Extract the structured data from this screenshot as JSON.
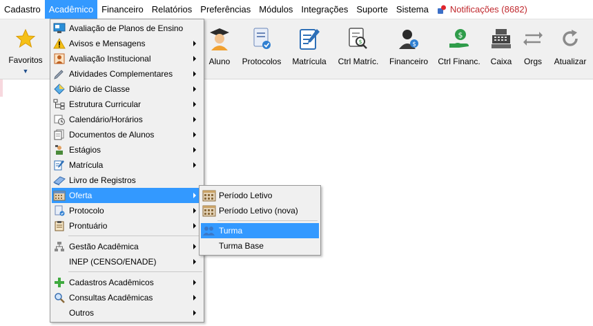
{
  "menubar": {
    "items": [
      {
        "label": "Cadastro"
      },
      {
        "label": "Acadêmico"
      },
      {
        "label": "Financeiro"
      },
      {
        "label": "Relatórios"
      },
      {
        "label": "Preferências"
      },
      {
        "label": "Módulos"
      },
      {
        "label": "Integrações"
      },
      {
        "label": "Suporte"
      },
      {
        "label": "Sistema"
      }
    ],
    "notifications": "Notificações (8682)"
  },
  "toolbar": {
    "favoritos": "Favoritos",
    "buttons": [
      {
        "label": "Aluno",
        "icon": "student-icon"
      },
      {
        "label": "Protocolos",
        "icon": "document-check-icon"
      },
      {
        "label": "Matrícula",
        "icon": "edit-document-icon"
      },
      {
        "label": "Ctrl Matríc.",
        "icon": "search-document-icon"
      },
      {
        "label": "Financeiro",
        "icon": "user-money-icon"
      },
      {
        "label": "Ctrl Financ.",
        "icon": "hand-money-icon"
      },
      {
        "label": "Caixa",
        "icon": "cash-register-icon"
      },
      {
        "label": "Orgs",
        "icon": "swap-arrows-icon"
      },
      {
        "label": "Atualizar",
        "icon": "refresh-icon"
      }
    ]
  },
  "dropdown": {
    "items": [
      {
        "label": "Avaliação de Planos de Ensino",
        "icon": "monitor-icon",
        "submenu": false
      },
      {
        "label": "Avisos e Mensagens",
        "icon": "warning-icon",
        "submenu": true
      },
      {
        "label": "Avaliação Institucional",
        "icon": "user-icon",
        "submenu": true
      },
      {
        "label": "Atividades Complementares",
        "icon": "pencil-icon",
        "submenu": true
      },
      {
        "label": "Diário de Classe",
        "icon": "diamond-icon",
        "submenu": true
      },
      {
        "label": "Estrutura Curricular",
        "icon": "tree-icon",
        "submenu": true
      },
      {
        "label": "Calendário/Horários",
        "icon": "clock-icon",
        "submenu": true
      },
      {
        "label": "Documentos de Alunos",
        "icon": "documents-icon",
        "submenu": true
      },
      {
        "label": "Estágios",
        "icon": "intern-icon",
        "submenu": true
      },
      {
        "label": "Matrícula",
        "icon": "edit-document-icon",
        "submenu": true
      },
      {
        "label": "Livro de Registros",
        "icon": "book-icon",
        "submenu": false
      },
      {
        "label": "Oferta",
        "icon": "calendar-icon",
        "submenu": true
      },
      {
        "label": "Protocolo",
        "icon": "document-check-icon",
        "submenu": true
      },
      {
        "label": "Prontuário",
        "icon": "clipboard-icon",
        "submenu": true
      },
      {
        "label": "Gestão Acadêmica",
        "icon": "hierarchy-icon",
        "submenu": true
      },
      {
        "label": "INEP (CENSO/ENADE)",
        "icon": "",
        "submenu": true
      },
      {
        "label": "Cadastros Acadêmicos",
        "icon": "plus-icon",
        "submenu": true
      },
      {
        "label": "Consultas Acadêmicas",
        "icon": "search-icon",
        "submenu": true
      },
      {
        "label": "Outros",
        "icon": "",
        "submenu": true
      }
    ]
  },
  "submenu": {
    "items": [
      {
        "label": "Período Letivo",
        "icon": "calendar-icon"
      },
      {
        "label": "Período Letivo (nova)",
        "icon": "calendar-icon"
      },
      {
        "label": "Turma",
        "icon": "group-icon"
      },
      {
        "label": "Turma Base",
        "icon": ""
      }
    ]
  },
  "colors": {
    "highlight": "#3399ff",
    "notification": "#c0282d",
    "menu_bg": "#f0f0f0"
  }
}
